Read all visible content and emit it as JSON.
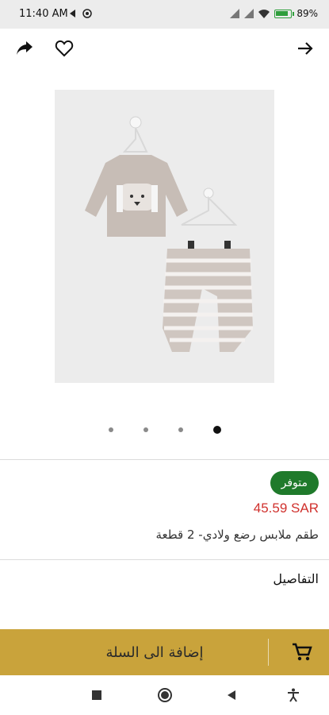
{
  "status_bar": {
    "time": "11:40 AM",
    "battery_percent": "89%",
    "battery_level": 0.89,
    "icons": [
      "play-icon",
      "whatsapp-icon",
      "signal-icon",
      "signal-icon",
      "wifi-icon",
      "battery-charging-icon"
    ]
  },
  "top_bar": {
    "icons": [
      "share-icon",
      "heart-icon",
      "arrow-forward-icon"
    ]
  },
  "product": {
    "image_icon": "baby-clothing-set-photo",
    "badge": "متوفر",
    "price": "45.59 SAR",
    "title": "طقم ملابس رضع ولادي- 2 قطعة",
    "details_label": "التفاصيل",
    "carousel": {
      "count": 4,
      "active_index": 3
    }
  },
  "add_to_cart": {
    "label": "إضافة الى السلة",
    "icon": "cart-icon",
    "color": "#c9a33b"
  },
  "colors": {
    "badge_bg": "#1f7a2b",
    "price": "#d0312d"
  },
  "nav_bar": {
    "icons": [
      "recent-apps-icon",
      "home-icon",
      "back-icon",
      "accessibility-icon"
    ]
  }
}
